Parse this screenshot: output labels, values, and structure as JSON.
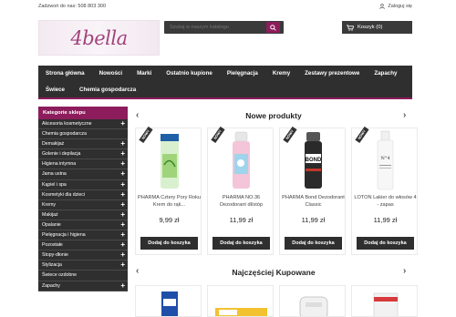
{
  "topbar": {
    "phone_text": "Zadzwoń do nas: 508 803 300",
    "login_label": "Zaloguj się"
  },
  "logo": {
    "text": "4bella"
  },
  "search": {
    "placeholder": "Szukaj w naszym katalogu"
  },
  "cart": {
    "label": "Koszyk (0)"
  },
  "nav": {
    "items": [
      "Strona główna",
      "Nowości",
      "Marki",
      "Ostatnio kupione",
      "Pielęgnacja",
      "Kremy",
      "Zestawy prezentowe",
      "Zapachy",
      "Świece",
      "Chemia gospodarcza"
    ]
  },
  "sidebar": {
    "title": "Kategorie sklepu",
    "items": [
      {
        "label": "Akcesoria kosmetyczne",
        "has_children": true
      },
      {
        "label": "Chemia gospodarcza",
        "has_children": false
      },
      {
        "label": "Demakijaż",
        "has_children": true
      },
      {
        "label": "Golenie i depilacja",
        "has_children": true
      },
      {
        "label": "Higiena intymna",
        "has_children": true
      },
      {
        "label": "Jama ustna",
        "has_children": true
      },
      {
        "label": "Kąpiel i spa",
        "has_children": true
      },
      {
        "label": "Kosmetyki dla dzieci",
        "has_children": true
      },
      {
        "label": "Kremy",
        "has_children": true
      },
      {
        "label": "Makijaż",
        "has_children": true
      },
      {
        "label": "Opalanie",
        "has_children": true
      },
      {
        "label": "Pielęgnacja i higiena",
        "has_children": true
      },
      {
        "label": "Pozostałe",
        "has_children": true
      },
      {
        "label": "Stopy-dłonie",
        "has_children": true
      },
      {
        "label": "Stylizacja",
        "has_children": true
      },
      {
        "label": "Świece ozdobne",
        "has_children": false
      },
      {
        "label": "Zapachy",
        "has_children": true
      }
    ]
  },
  "new_products": {
    "title": "Nowe produkty",
    "badge": "NOWY",
    "add_label": "Dodaj do koszyka",
    "items": [
      {
        "name": "PHARMA Cztery Pory Roku Krem do rąk...",
        "price": "9,99 zł"
      },
      {
        "name": "PHARMA NO.36 Dezodorant dł/stóp",
        "price": "11,99 zł"
      },
      {
        "name": "PHARMA Bond Dezodorant Classic",
        "price": "11,99 zł"
      },
      {
        "name": "LOTON Lakier do włosów 4 - zapas",
        "price": "11,99 zł"
      }
    ]
  },
  "best_sellers": {
    "title": "Najczęściej Kupowane"
  },
  "colors": {
    "accent": "#8d1c5c",
    "dark": "#2f2f2f"
  }
}
